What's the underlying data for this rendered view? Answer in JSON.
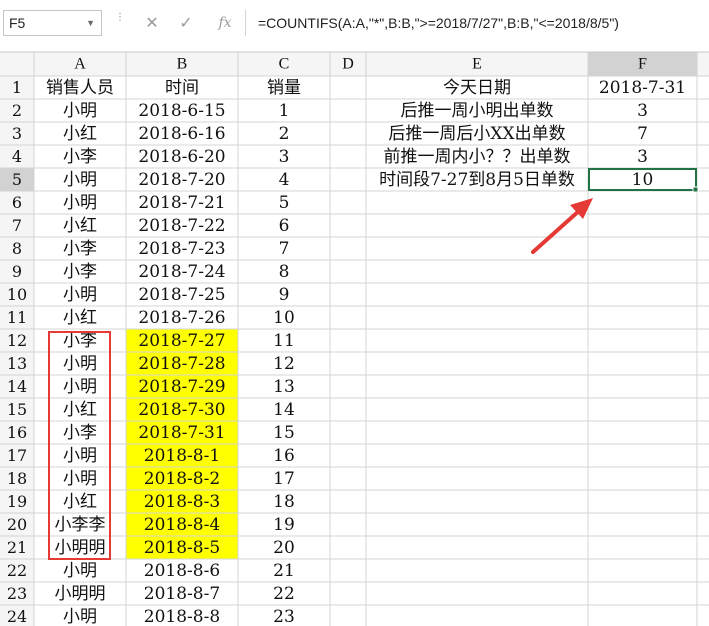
{
  "name_box": "F5",
  "formula": "=COUNTIFS(A:A,\"*\",B:B,\">=2018/7/27\",B:B,\"<=2018/8/5\")",
  "formula_bar_icons": [
    "cancel-icon",
    "confirm-icon",
    "fx-icon"
  ],
  "columns": [
    "A",
    "B",
    "C",
    "D",
    "E",
    "F"
  ],
  "row_numbers": [
    "1",
    "2",
    "3",
    "4",
    "5",
    "6",
    "7",
    "8",
    "9",
    "10",
    "11",
    "12",
    "13",
    "14",
    "15",
    "16",
    "17",
    "18",
    "19",
    "20",
    "21",
    "22",
    "23",
    "24"
  ],
  "selected_cell": "F5",
  "rows": [
    {
      "a": "销售人员",
      "b": "时间",
      "c": "销量",
      "e": "今天日期",
      "f": "2018-7-31"
    },
    {
      "a": "小明",
      "b": "2018-6-15",
      "c": "1",
      "e": "后推一周小明出单数",
      "f": "3"
    },
    {
      "a": "小红",
      "b": "2018-6-16",
      "c": "2",
      "e": "后推一周后小XX出单数",
      "f": "7"
    },
    {
      "a": "小李",
      "b": "2018-6-20",
      "c": "3",
      "e": "前推一周内小？？出单数",
      "f": "3"
    },
    {
      "a": "小明",
      "b": "2018-7-20",
      "c": "4",
      "e": "时间段7-27到8月5日单数",
      "f": "10"
    },
    {
      "a": "小明",
      "b": "2018-7-21",
      "c": "5",
      "e": "",
      "f": ""
    },
    {
      "a": "小红",
      "b": "2018-7-22",
      "c": "6",
      "e": "",
      "f": ""
    },
    {
      "a": "小李",
      "b": "2018-7-23",
      "c": "7",
      "e": "",
      "f": ""
    },
    {
      "a": "小李",
      "b": "2018-7-24",
      "c": "8",
      "e": "",
      "f": ""
    },
    {
      "a": "小明",
      "b": "2018-7-25",
      "c": "9",
      "e": "",
      "f": ""
    },
    {
      "a": "小红",
      "b": "2018-7-26",
      "c": "10",
      "e": "",
      "f": ""
    },
    {
      "a": "小李",
      "b": "2018-7-27",
      "c": "11",
      "e": "",
      "f": ""
    },
    {
      "a": "小明",
      "b": "2018-7-28",
      "c": "12",
      "e": "",
      "f": ""
    },
    {
      "a": "小明",
      "b": "2018-7-29",
      "c": "13",
      "e": "",
      "f": ""
    },
    {
      "a": "小红",
      "b": "2018-7-30",
      "c": "14",
      "e": "",
      "f": ""
    },
    {
      "a": "小李",
      "b": "2018-7-31",
      "c": "15",
      "e": "",
      "f": ""
    },
    {
      "a": "小明",
      "b": "2018-8-1",
      "c": "16",
      "e": "",
      "f": ""
    },
    {
      "a": "小明",
      "b": "2018-8-2",
      "c": "17",
      "e": "",
      "f": ""
    },
    {
      "a": "小红",
      "b": "2018-8-3",
      "c": "18",
      "e": "",
      "f": ""
    },
    {
      "a": "小李李",
      "b": "2018-8-4",
      "c": "19",
      "e": "",
      "f": ""
    },
    {
      "a": "小明明",
      "b": "2018-8-5",
      "c": "20",
      "e": "",
      "f": ""
    },
    {
      "a": "小明",
      "b": "2018-8-6",
      "c": "21",
      "e": "",
      "f": ""
    },
    {
      "a": "小明明",
      "b": "2018-8-7",
      "c": "22",
      "e": "",
      "f": ""
    },
    {
      "a": "小明",
      "b": "2018-8-8",
      "c": "23",
      "e": "",
      "f": ""
    }
  ],
  "highlight_rows": [
    "12",
    "13",
    "14",
    "15",
    "16",
    "17",
    "18",
    "19",
    "20",
    "21"
  ],
  "colors": {
    "highlight_fill": "#ffff00",
    "annotation_red": "#e53935",
    "selection_green": "#217346",
    "header_fill": "#f5f5f5",
    "grid_line": "#d4d4d4"
  }
}
